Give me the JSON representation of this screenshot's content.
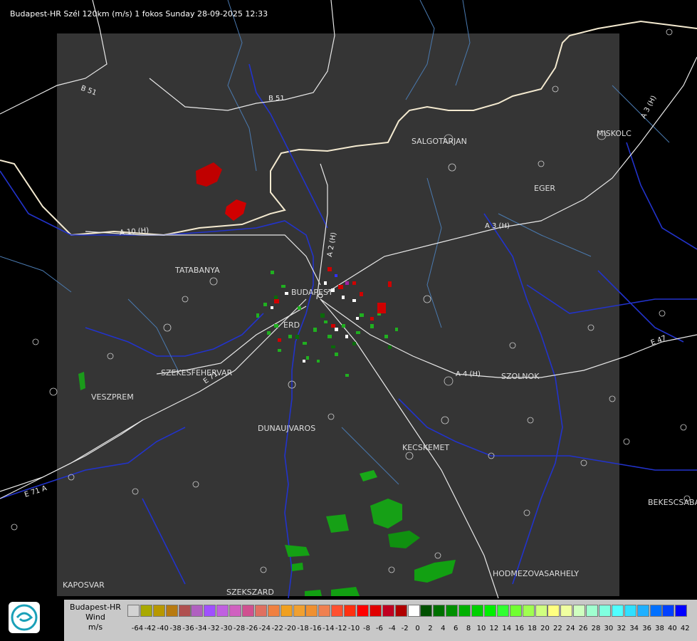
{
  "header": {
    "title": "Budapest-HR Szél 120km (m/s) 1 fokos Sunday 28-09-2025 12:33"
  },
  "cities": [
    {
      "name": "TATABANYA"
    },
    {
      "name": "BUDAPEST"
    },
    {
      "name": "ERD"
    },
    {
      "name": "SZEKESFEHERVAR"
    },
    {
      "name": "VESZPREM"
    },
    {
      "name": "DUNAUJVAROS"
    },
    {
      "name": "KECSKEMET"
    },
    {
      "name": "SALGOTARJAN"
    },
    {
      "name": "EGER"
    },
    {
      "name": "MISKOLC"
    },
    {
      "name": "SZOLNOK"
    },
    {
      "name": "BEKESCSABA"
    },
    {
      "name": "HODMEZOVASARHELY"
    },
    {
      "name": "KAPOSVAR"
    },
    {
      "name": "SZEKSZARD"
    }
  ],
  "roads": [
    {
      "name": "B 51"
    },
    {
      "name": "B 51"
    },
    {
      "name": "A 3 (H)"
    },
    {
      "name": "A 3 (H)"
    },
    {
      "name": "A 4 (H)"
    },
    {
      "name": "E 47"
    },
    {
      "name": "A 2 (H)"
    },
    {
      "name": "A 10 (H)"
    },
    {
      "name": "E 71"
    },
    {
      "name": "E 71 A"
    }
  ],
  "legend": {
    "line1": "Budapest-HR",
    "line2": "Wind",
    "line3": "m/s",
    "colors": [
      "#d3d3d3",
      "#a9a900",
      "#b89800",
      "#b87a10",
      "#b05050",
      "#b060c0",
      "#a050ff",
      "#c060e0",
      "#d060c0",
      "#d05090",
      "#e07060",
      "#f08040",
      "#f0a020",
      "#f0a030",
      "#f09030",
      "#f08050",
      "#ff5030",
      "#ff3010",
      "#ff0000",
      "#e00000",
      "#c00020",
      "#b00000",
      "#ffffff",
      "#005000",
      "#007000",
      "#009000",
      "#00b000",
      "#00d000",
      "#00f000",
      "#30ff30",
      "#70ff30",
      "#a0ff50",
      "#d0ff80",
      "#ffff80",
      "#f0ffa0",
      "#d0ffc0",
      "#a0ffd0",
      "#80ffe0",
      "#50ffff",
      "#30e0ff",
      "#20b0ff",
      "#0070ff",
      "#0040ff",
      "#0000ff"
    ],
    "ticks": [
      "-64",
      "-42",
      "-40",
      "-38",
      "-36",
      "-34",
      "-32",
      "-30",
      "-28",
      "-26",
      "-24",
      "-22",
      "-20",
      "-18",
      "-16",
      "-14",
      "-12",
      "-10",
      "-8",
      "-6",
      "-4",
      "-2",
      "0",
      "2",
      "4",
      "6",
      "8",
      "10",
      "12",
      "14",
      "16",
      "18",
      "20",
      "22",
      "24",
      "26",
      "28",
      "30",
      "32",
      "34",
      "36",
      "38",
      "40",
      "42"
    ]
  }
}
